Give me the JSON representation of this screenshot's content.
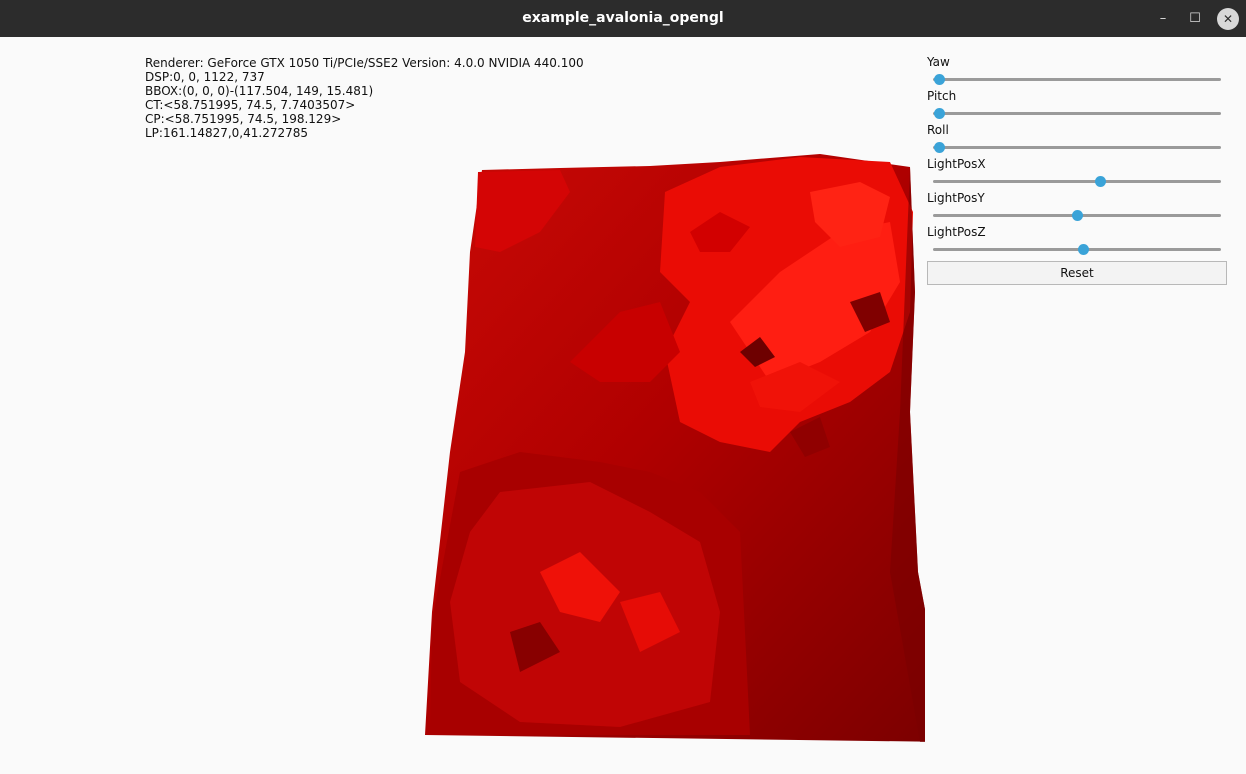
{
  "window": {
    "title": "example_avalonia_opengl",
    "controls": {
      "minimize": "–",
      "maximize": "☐",
      "close": "✕"
    }
  },
  "info": {
    "renderer": "Renderer: GeForce GTX 1050 Ti/PCIe/SSE2 Version: 4.0.0 NVIDIA 440.100",
    "dsp": "DSP:0, 0, 1122, 737",
    "bbox": "BBOX:(0, 0, 0)-(117.504, 149, 15.481)",
    "ct": "CT:<58.751995, 74.5, 7.7403507>",
    "cp": "CP:<58.751995, 74.5, 198.129>",
    "lp": "LP:161.14827,0,41.272785"
  },
  "controls": {
    "sliders": [
      {
        "label": "Yaw",
        "value": 0.02
      },
      {
        "label": "Pitch",
        "value": 0.02
      },
      {
        "label": "Roll",
        "value": 0.02
      },
      {
        "label": "LightPosX",
        "value": 0.58
      },
      {
        "label": "LightPosY",
        "value": 0.5
      },
      {
        "label": "LightPosZ",
        "value": 0.52
      }
    ],
    "reset_label": "Reset"
  },
  "colors": {
    "accent": "#3aa3d8",
    "terrain_light": "#ff1a10",
    "terrain_dark": "#850000"
  }
}
